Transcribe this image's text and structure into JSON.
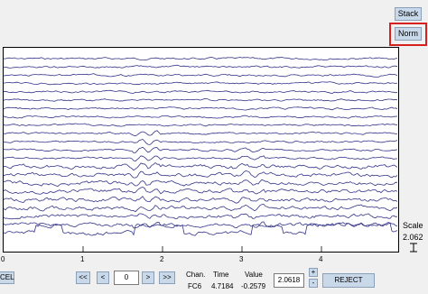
{
  "side_panel": {
    "stack_label": "Stack",
    "norm_label": "Norm",
    "scale_label": "Scale",
    "scale_value": "2.062",
    "scale_icon": "scale-bar-icon"
  },
  "x_axis": {
    "ticks": [
      "0",
      "1",
      "2",
      "3",
      "4"
    ]
  },
  "nav": {
    "reject_left_label": "CEL",
    "first_label": "<<",
    "prev_label": "<",
    "page_value": "0",
    "next_label": ">",
    "last_label": ">>"
  },
  "info": {
    "chan_header": "Chan.",
    "time_header": "Time",
    "value_header": "Value",
    "chan_value": "FC6",
    "time_value": "4.7184",
    "value_value": "-0.2579",
    "scale_field": "2.0618",
    "plus_label": "+",
    "minus_label": "-",
    "reject_label": "REJECT"
  },
  "colors": {
    "trace": "#33338a",
    "highlight": "#d62020",
    "button_bg": "#c9d9ea"
  },
  "chart_data": {
    "type": "line",
    "channel_count": 22,
    "xlim": [
      0,
      5
    ],
    "x_ticks": [
      0,
      1,
      2,
      3,
      4
    ]
  }
}
